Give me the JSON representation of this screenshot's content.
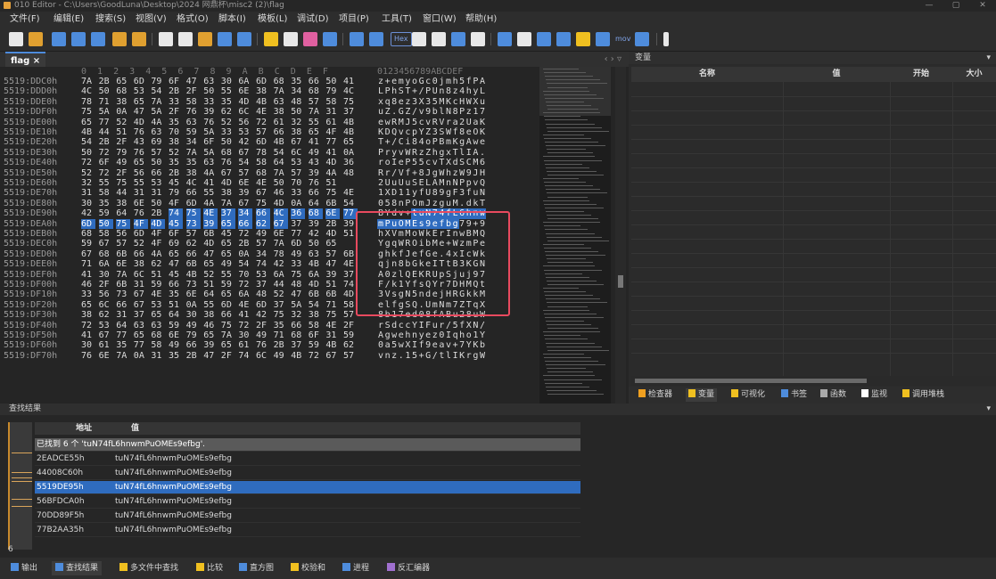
{
  "window": {
    "title": "010 Editor - C:\\Users\\GoodLuna\\Desktop\\2024 网鼎杯\\misc2 (2)\\flag",
    "minimize": "—",
    "maximize": "▢",
    "close": "✕"
  },
  "menu": [
    "文件(F)",
    "编辑(E)",
    "搜索(S)",
    "视图(V)",
    "格式(O)",
    "脚本(I)",
    "模板(L)",
    "调试(D)",
    "项目(P)",
    "工具(T)",
    "窗口(W)",
    "帮助(H)"
  ],
  "toolbar": {
    "hex_label": "Hex",
    "mov_label": "mov"
  },
  "editor": {
    "tab_label": "flag ×",
    "tab_nav": "‹ › ▿",
    "header_hex": "0  1  2  3  4  5  6  7  8  9  A  B  C  D  E  F",
    "header_ascii": "0123456789ABCDEF",
    "rows": [
      {
        "addr": "5519:DDC0h",
        "hex": [
          "7A",
          "2B",
          "65",
          "6D",
          "79",
          "6F",
          "47",
          "63",
          "30",
          "6A",
          "6D",
          "68",
          "35",
          "66",
          "50",
          "41"
        ],
        "ascii": "z+emyoGc0jmh5fPA"
      },
      {
        "addr": "5519:DDD0h",
        "hex": [
          "4C",
          "50",
          "68",
          "53",
          "54",
          "2B",
          "2F",
          "50",
          "55",
          "6E",
          "38",
          "7A",
          "34",
          "68",
          "79",
          "4C"
        ],
        "ascii": "LPhST+/PUn8z4hyL"
      },
      {
        "addr": "5519:DDE0h",
        "hex": [
          "78",
          "71",
          "38",
          "65",
          "7A",
          "33",
          "58",
          "33",
          "35",
          "4D",
          "4B",
          "63",
          "48",
          "57",
          "58",
          "75"
        ],
        "ascii": "xq8ez3X35MKcHWXu"
      },
      {
        "addr": "5519:DDF0h",
        "hex": [
          "75",
          "5A",
          "0A",
          "47",
          "5A",
          "2F",
          "76",
          "39",
          "62",
          "6C",
          "4E",
          "38",
          "50",
          "7A",
          "31",
          "37"
        ],
        "ascii": "uZ.GZ/v9blN8Pz17"
      },
      {
        "addr": "5519:DE00h",
        "hex": [
          "65",
          "77",
          "52",
          "4D",
          "4A",
          "35",
          "63",
          "76",
          "52",
          "56",
          "72",
          "61",
          "32",
          "55",
          "61",
          "4B"
        ],
        "ascii": "ewRMJ5cvRVra2UaK"
      },
      {
        "addr": "5519:DE10h",
        "hex": [
          "4B",
          "44",
          "51",
          "76",
          "63",
          "70",
          "59",
          "5A",
          "33",
          "53",
          "57",
          "66",
          "38",
          "65",
          "4F",
          "4B"
        ],
        "ascii": "KDQvcpYZ3SWf8eOK"
      },
      {
        "addr": "5519:DE20h",
        "hex": [
          "54",
          "2B",
          "2F",
          "43",
          "69",
          "38",
          "34",
          "6F",
          "50",
          "42",
          "6D",
          "4B",
          "67",
          "41",
          "77",
          "65"
        ],
        "ascii": "T+/Ci84oPBmKgAwe"
      },
      {
        "addr": "5519:DE30h",
        "hex": [
          "50",
          "72",
          "79",
          "76",
          "57",
          "52",
          "7A",
          "5A",
          "68",
          "67",
          "78",
          "54",
          "6C",
          "49",
          "41",
          "0A"
        ],
        "ascii": "PryvWRzZhgxTlIA."
      },
      {
        "addr": "5519:DE40h",
        "hex": [
          "72",
          "6F",
          "49",
          "65",
          "50",
          "35",
          "35",
          "63",
          "76",
          "54",
          "58",
          "64",
          "53",
          "43",
          "4D",
          "36"
        ],
        "ascii": "roIeP55cvTXdSCM6"
      },
      {
        "addr": "5519:DE50h",
        "hex": [
          "52",
          "72",
          "2F",
          "56",
          "66",
          "2B",
          "38",
          "4A",
          "67",
          "57",
          "68",
          "7A",
          "57",
          "39",
          "4A",
          "48"
        ],
        "ascii": "Rr/Vf+8JgWhzW9JH"
      },
      {
        "addr": "5519:DE60h",
        "hex": [
          "32",
          "55",
          "75",
          "55",
          "53",
          "45",
          "4C",
          "41",
          "4D",
          "6E",
          "4E",
          "50",
          "70",
          "76",
          "51",
          " "
        ],
        "ascii": "2UuUuSELAMnNPpvQ"
      },
      {
        "addr": "5519:DE70h",
        "hex": [
          "31",
          "58",
          "44",
          "31",
          "31",
          "79",
          "66",
          "55",
          "38",
          "39",
          "67",
          "46",
          "33",
          "66",
          "75",
          "4E"
        ],
        "ascii": "1XD11yfU89gF3fuN"
      },
      {
        "addr": "5519:DE80h",
        "hex": [
          "30",
          "35",
          "38",
          "6E",
          "50",
          "4F",
          "6D",
          "4A",
          "7A",
          "67",
          "75",
          "4D",
          "0A",
          "64",
          "6B",
          "54"
        ],
        "ascii": "058nPOmJzguM.dkT"
      },
      {
        "addr": "5519:DE90h",
        "hex": [
          "42",
          "59",
          "64",
          "76",
          "2B",
          "74",
          "75",
          "4E",
          "37",
          "34",
          "66",
          "4C",
          "36",
          "68",
          "6E",
          "77"
        ],
        "ascii": "BYdv+tuN74fL6hnw",
        "sel_from": 5
      },
      {
        "addr": "5519:DEA0h",
        "hex": [
          "6D",
          "50",
          "75",
          "4F",
          "4D",
          "45",
          "73",
          "39",
          "65",
          "66",
          "62",
          "67",
          "37",
          "39",
          "2B",
          "39"
        ],
        "ascii": "mPuOMEs9efbg79+9",
        "sel_to": 11
      },
      {
        "addr": "5519:DEB0h",
        "hex": [
          "68",
          "58",
          "56",
          "6D",
          "4F",
          "6F",
          "57",
          "6B",
          "45",
          "72",
          "49",
          "6E",
          "77",
          "42",
          "4D",
          "51"
        ],
        "ascii": "hXVmMoWkErInwBMQ"
      },
      {
        "addr": "5519:DEC0h",
        "hex": [
          "59",
          "67",
          "57",
          "52",
          "4F",
          "69",
          "62",
          "4D",
          "65",
          "2B",
          "57",
          "7A",
          "6D",
          "50",
          "65",
          " "
        ],
        "ascii": "YgqWROibMe+WzmPe"
      },
      {
        "addr": "5519:DED0h",
        "hex": [
          "67",
          "68",
          "6B",
          "66",
          "4A",
          "65",
          "66",
          "47",
          "65",
          "0A",
          "34",
          "78",
          "49",
          "63",
          "57",
          "6B"
        ],
        "ascii": "ghkfJefGe.4xIcWk"
      },
      {
        "addr": "5519:DEE0h",
        "hex": [
          "71",
          "6A",
          "6E",
          "38",
          "62",
          "47",
          "6B",
          "65",
          "49",
          "54",
          "74",
          "42",
          "33",
          "4B",
          "47",
          "4E"
        ],
        "ascii": "qjn8bGkeITtB3KGN"
      },
      {
        "addr": "5519:DEF0h",
        "hex": [
          "41",
          "30",
          "7A",
          "6C",
          "51",
          "45",
          "4B",
          "52",
          "55",
          "70",
          "53",
          "6A",
          "75",
          "6A",
          "39",
          "37"
        ],
        "ascii": "A0zlQEKRUpSjuj97"
      },
      {
        "addr": "5519:DF00h",
        "hex": [
          "46",
          "2F",
          "6B",
          "31",
          "59",
          "66",
          "73",
          "51",
          "59",
          "72",
          "37",
          "44",
          "48",
          "4D",
          "51",
          "74"
        ],
        "ascii": "F/k1YfsQYr7DHMQt"
      },
      {
        "addr": "5519:DF10h",
        "hex": [
          "33",
          "56",
          "73",
          "67",
          "4E",
          "35",
          "6E",
          "64",
          "65",
          "6A",
          "48",
          "52",
          "47",
          "6B",
          "6B",
          "4D"
        ],
        "ascii": "3VsgN5ndejHRGkkM"
      },
      {
        "addr": "5519:DF20h",
        "hex": [
          "65",
          "6C",
          "66",
          "67",
          "53",
          "51",
          "0A",
          "55",
          "6D",
          "4E",
          "6D",
          "37",
          "5A",
          "54",
          "71",
          "58"
        ],
        "ascii": "elfgSQ.UmNm7ZTqX"
      },
      {
        "addr": "5519:DF30h",
        "hex": [
          "38",
          "62",
          "31",
          "37",
          "65",
          "64",
          "30",
          "38",
          "66",
          "41",
          "42",
          "75",
          "32",
          "38",
          "75",
          "57"
        ],
        "ascii": "8b17ed08fABu28uW"
      },
      {
        "addr": "5519:DF40h",
        "hex": [
          "72",
          "53",
          "64",
          "63",
          "63",
          "59",
          "49",
          "46",
          "75",
          "72",
          "2F",
          "35",
          "66",
          "58",
          "4E",
          "2F"
        ],
        "ascii": "rSdccYIFur/5fXN/"
      },
      {
        "addr": "5519:DF50h",
        "hex": [
          "41",
          "67",
          "77",
          "65",
          "68",
          "6E",
          "79",
          "65",
          "7A",
          "30",
          "49",
          "71",
          "68",
          "6F",
          "31",
          "59"
        ],
        "ascii": "Agwehnyez0Iqho1Y"
      },
      {
        "addr": "5519:DF60h",
        "hex": [
          "30",
          "61",
          "35",
          "77",
          "58",
          "49",
          "66",
          "39",
          "65",
          "61",
          "76",
          "2B",
          "37",
          "59",
          "4B",
          "62"
        ],
        "ascii": "0a5wXIf9eav+7YKb"
      },
      {
        "addr": "5519:DF70h",
        "hex": [
          "76",
          "6E",
          "7A",
          "0A",
          "31",
          "35",
          "2B",
          "47",
          "2F",
          "74",
          "6C",
          "49",
          "4B",
          "72",
          "67",
          "57"
        ],
        "ascii": "vnz.15+G/tlIKrgW"
      }
    ]
  },
  "variables": {
    "panel_title": "变量",
    "close": "▾",
    "columns": [
      "名称",
      "值",
      "开始",
      "大小"
    ]
  },
  "right_tabs": [
    {
      "label": "检查器",
      "color": "#f0a020"
    },
    {
      "label": "变量",
      "color": "#f0c020"
    },
    {
      "label": "可视化",
      "color": "#f0c020"
    },
    {
      "label": "书签",
      "color": "#4e8cdc"
    },
    {
      "label": "函数",
      "color": "#aaaaaa"
    },
    {
      "label": "监视",
      "color": "#ffffff"
    },
    {
      "label": "调用堆栈",
      "color": "#f0c020"
    }
  ],
  "find": {
    "panel_title": "查找结果",
    "close": "▾",
    "col_address": "地址",
    "col_value": "值",
    "summary": "已找到 6 个 'tuN74fL6hnwmPuOMEs9efbg'.",
    "results": [
      {
        "address": "2EADCE55h",
        "value": "tuN74fL6hnwmPuOMEs9efbg"
      },
      {
        "address": "44008C60h",
        "value": "tuN74fL6hnwmPuOMEs9efbg"
      },
      {
        "address": "5519DE95h",
        "value": "tuN74fL6hnwmPuOMEs9efbg"
      },
      {
        "address": "56BFDCA0h",
        "value": "tuN74fL6hnwmPuOMEs9efbg"
      },
      {
        "address": "70DD89F5h",
        "value": "tuN74fL6hnwmPuOMEs9efbg"
      },
      {
        "address": "77B2AA35h",
        "value": "tuN74fL6hnwmPuOMEs9efbg"
      }
    ],
    "selected_index": 2,
    "count": "6"
  },
  "bottom_tabs": [
    {
      "label": "输出",
      "color": "#4e8cdc"
    },
    {
      "label": "查找结果",
      "color": "#4e8cdc"
    },
    {
      "label": "多文件中查找",
      "color": "#f0c020"
    },
    {
      "label": "比较",
      "color": "#f0c020"
    },
    {
      "label": "直方图",
      "color": "#4e8cdc"
    },
    {
      "label": "校验和",
      "color": "#f0c020"
    },
    {
      "label": "进程",
      "color": "#4e8cdc"
    },
    {
      "label": "反汇编器",
      "color": "#a070d0"
    }
  ]
}
